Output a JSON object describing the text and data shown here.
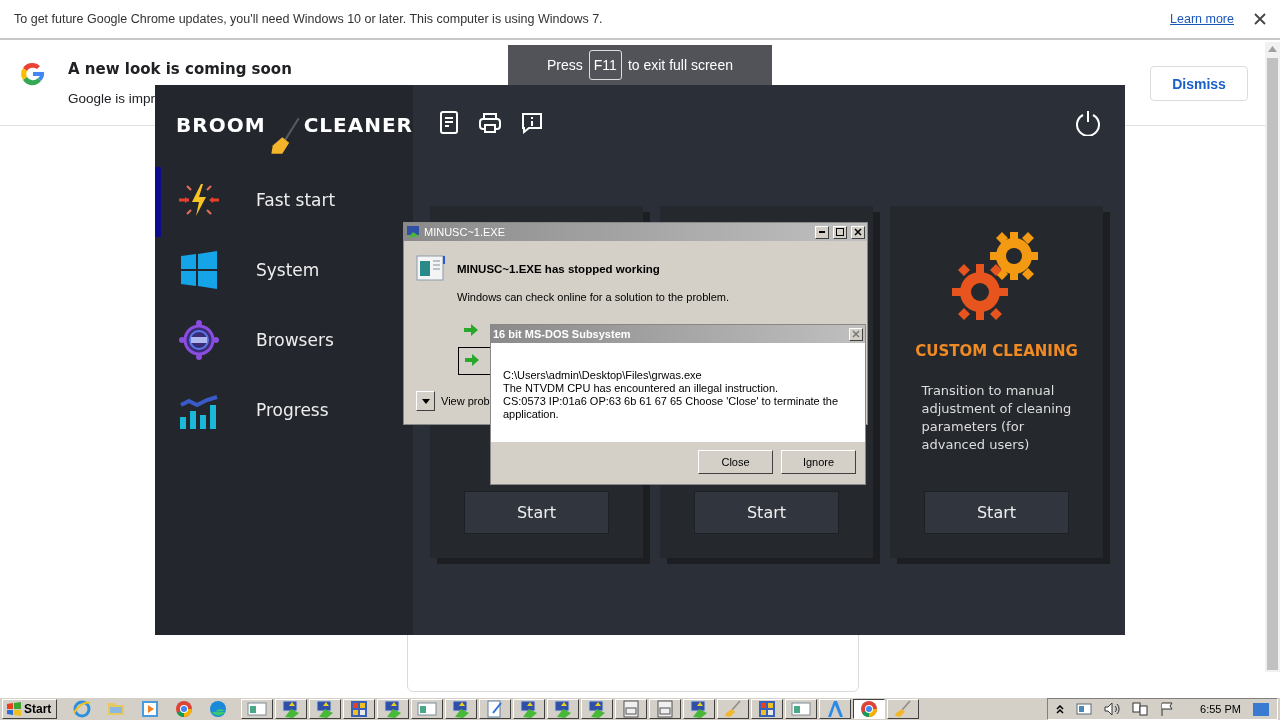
{
  "chrome_infobar": {
    "message": "To get future Google Chrome updates, you'll need Windows 10 or later. This computer is using Windows 7.",
    "link": "Learn more"
  },
  "google_banner": {
    "title": "A new look is coming soon",
    "text": "Google is impr",
    "button": "Dismiss"
  },
  "fullscreen_hint": {
    "before": "Press",
    "key": "F11",
    "after": "to exit full screen"
  },
  "app": {
    "logo_left": "BROOM",
    "logo_right": "CLEANER",
    "toolbar": [
      {
        "kind": "document"
      },
      {
        "kind": "printer"
      },
      {
        "kind": "message"
      }
    ],
    "nav": [
      {
        "label": "Fast start",
        "kind": "bolt",
        "selected": true
      },
      {
        "label": "System",
        "kind": "windows",
        "selected": false
      },
      {
        "label": "Browsers",
        "kind": "target",
        "selected": false
      },
      {
        "label": "Progress",
        "kind": "chart",
        "selected": false
      }
    ],
    "cards": [
      {
        "button": "Start"
      },
      {
        "button": "Start"
      },
      {
        "kind": "gears",
        "title": "CUSTOM CLEANING",
        "text": "Transition to manual adjustment of cleaning parameters (for advanced users)",
        "button": "Start"
      }
    ]
  },
  "error_dialog": {
    "title": "MINUSC~1.EXE",
    "heading": "MINUSC~1.EXE has stopped working",
    "text": "Windows can check online for a solution to the problem.",
    "details": "View prob"
  },
  "dos_dialog": {
    "title": "16 bit MS-DOS Subsystem",
    "lines": [
      "C:\\Users\\admin\\Desktop\\Files\\grwas.exe",
      "The NTVDM CPU has encountered an illegal instruction.",
      "CS:0573 IP:01a6 OP:63 6b 61 67 65 Choose 'Close' to terminate the application."
    ],
    "buttons": [
      "Close",
      "Ignore"
    ]
  },
  "taskbar": {
    "start": "Start",
    "quick_launch": [
      {
        "kind": "ie"
      },
      {
        "kind": "folder"
      },
      {
        "kind": "media"
      },
      {
        "kind": "chrome"
      },
      {
        "kind": "edge"
      }
    ],
    "buttons": [
      {
        "kind": "window",
        "selected": false
      },
      {
        "kind": "installer",
        "selected": false
      },
      {
        "kind": "installer",
        "selected": false
      },
      {
        "kind": "grid",
        "selected": false
      },
      {
        "kind": "installer",
        "selected": false
      },
      {
        "kind": "window",
        "selected": false
      },
      {
        "kind": "installer",
        "selected": false
      },
      {
        "kind": "notepad",
        "selected": false
      },
      {
        "kind": "installer",
        "selected": false
      },
      {
        "kind": "installer",
        "selected": false
      },
      {
        "kind": "installer",
        "selected": false
      },
      {
        "kind": "calc",
        "selected": false
      },
      {
        "kind": "calc",
        "selected": false
      },
      {
        "kind": "installer",
        "selected": false
      },
      {
        "kind": "broom",
        "selected": false
      },
      {
        "kind": "grid",
        "selected": false
      },
      {
        "kind": "window",
        "selected": false
      },
      {
        "kind": "font",
        "selected": false
      },
      {
        "kind": "chrome",
        "selected": true
      },
      {
        "kind": "broom",
        "selected": false
      }
    ],
    "clock": "6:55 PM"
  }
}
